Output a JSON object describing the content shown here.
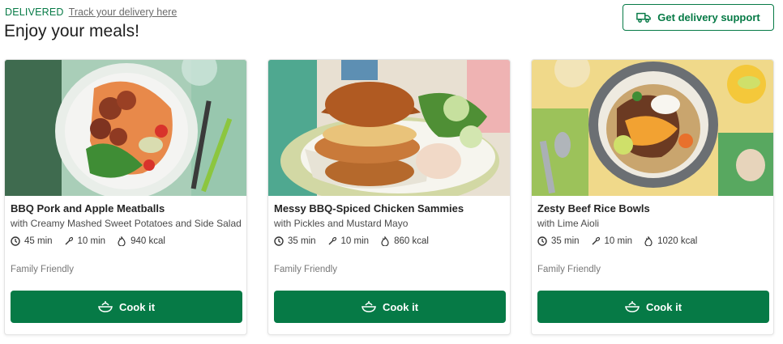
{
  "header": {
    "status": "DELIVERED",
    "track_link": "Track your delivery here",
    "title": "Enjoy your meals!",
    "support_button": "Get delivery support"
  },
  "meals": [
    {
      "title": "BBQ Pork and Apple Meatballs",
      "subtitle": "with Creamy Mashed Sweet Potatoes and Side Salad",
      "total_time": "45 min",
      "prep_time": "10 min",
      "calories": "940 kcal",
      "tag": "Family Friendly",
      "cook_button": "Cook it"
    },
    {
      "title": "Messy BBQ-Spiced Chicken Sammies",
      "subtitle": "with Pickles and Mustard Mayo",
      "total_time": "35 min",
      "prep_time": "10 min",
      "calories": "860 kcal",
      "tag": "Family Friendly",
      "cook_button": "Cook it"
    },
    {
      "title": "Zesty Beef Rice Bowls",
      "subtitle": "with Lime Aioli",
      "total_time": "35 min",
      "prep_time": "10 min",
      "calories": "1020 kcal",
      "tag": "Family Friendly",
      "cook_button": "Cook it"
    }
  ],
  "colors": {
    "brand_green": "#067a46"
  },
  "icons": [
    "truck-icon",
    "clock-icon",
    "whisk-icon",
    "flame-icon",
    "cooking-pot-icon"
  ]
}
